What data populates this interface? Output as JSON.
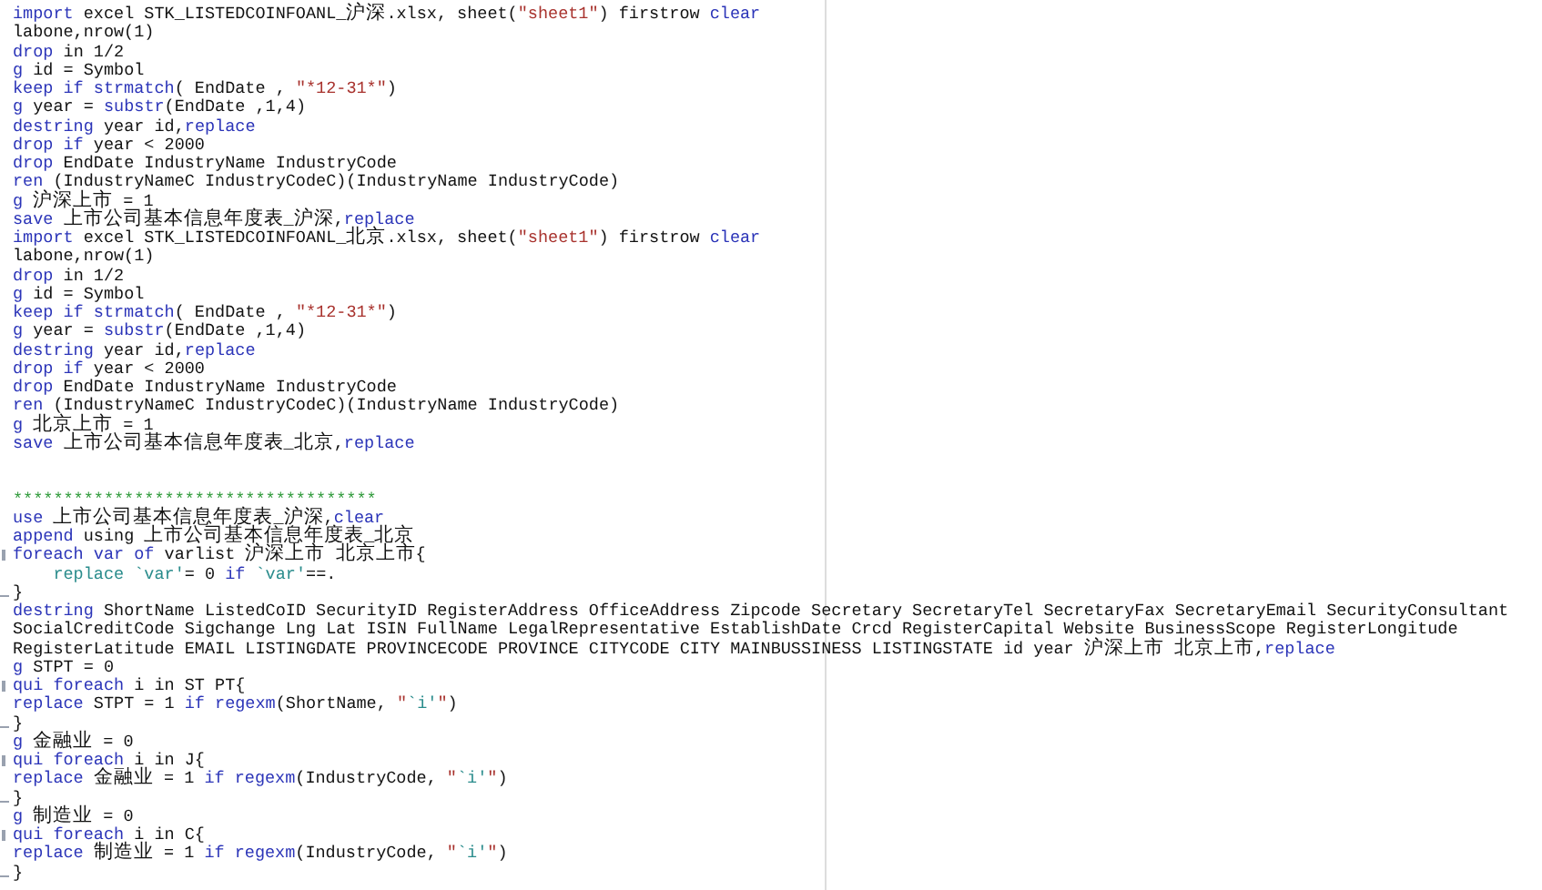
{
  "editor": {
    "lines": [
      {
        "kind": "code",
        "tokens": [
          {
            "kind": "keyword",
            "text": "import"
          },
          {
            "kind": "plain",
            "text": " excel STK_LISTEDCOINFOANL_沪深.xlsx, sheet("
          },
          {
            "kind": "string",
            "text": "\"sheet1\""
          },
          {
            "kind": "plain",
            "text": ") firstrow "
          },
          {
            "kind": "keyword",
            "text": "clear"
          }
        ]
      },
      {
        "kind": "code",
        "tokens": [
          {
            "kind": "plain",
            "text": "labone,nrow(1)"
          }
        ]
      },
      {
        "kind": "code",
        "tokens": [
          {
            "kind": "keyword",
            "text": "drop"
          },
          {
            "kind": "plain",
            "text": " in 1/2"
          }
        ]
      },
      {
        "kind": "code",
        "tokens": [
          {
            "kind": "keyword",
            "text": "g"
          },
          {
            "kind": "plain",
            "text": " id = Symbol"
          }
        ]
      },
      {
        "kind": "code",
        "tokens": [
          {
            "kind": "keyword",
            "text": "keep if strmatch"
          },
          {
            "kind": "plain",
            "text": "( EndDate , "
          },
          {
            "kind": "string",
            "text": "\"*12-31*\""
          },
          {
            "kind": "plain",
            "text": ")"
          }
        ]
      },
      {
        "kind": "code",
        "tokens": [
          {
            "kind": "keyword",
            "text": "g"
          },
          {
            "kind": "plain",
            "text": " year = "
          },
          {
            "kind": "keyword",
            "text": "substr"
          },
          {
            "kind": "plain",
            "text": "(EndDate ,1,4)"
          }
        ]
      },
      {
        "kind": "code",
        "tokens": [
          {
            "kind": "keyword",
            "text": "destring"
          },
          {
            "kind": "plain",
            "text": " year id,"
          },
          {
            "kind": "keyword",
            "text": "replace"
          }
        ]
      },
      {
        "kind": "code",
        "tokens": [
          {
            "kind": "keyword",
            "text": "drop if"
          },
          {
            "kind": "plain",
            "text": " year < 2000"
          }
        ]
      },
      {
        "kind": "code",
        "tokens": [
          {
            "kind": "keyword",
            "text": "drop"
          },
          {
            "kind": "plain",
            "text": " EndDate IndustryName IndustryCode"
          }
        ]
      },
      {
        "kind": "code",
        "tokens": [
          {
            "kind": "keyword",
            "text": "ren"
          },
          {
            "kind": "plain",
            "text": " (IndustryNameC IndustryCodeC)(IndustryName IndustryCode)"
          }
        ]
      },
      {
        "kind": "code",
        "tokens": [
          {
            "kind": "keyword",
            "text": "g"
          },
          {
            "kind": "plain",
            "text": " 沪深上市 = 1"
          }
        ]
      },
      {
        "kind": "code",
        "tokens": [
          {
            "kind": "keyword",
            "text": "save"
          },
          {
            "kind": "plain",
            "text": " 上市公司基本信息年度表_沪深,"
          },
          {
            "kind": "keyword",
            "text": "replace"
          }
        ]
      },
      {
        "kind": "code",
        "tokens": [
          {
            "kind": "keyword",
            "text": "import"
          },
          {
            "kind": "plain",
            "text": " excel STK_LISTEDCOINFOANL_北京.xlsx, sheet("
          },
          {
            "kind": "string",
            "text": "\"sheet1\""
          },
          {
            "kind": "plain",
            "text": ") firstrow "
          },
          {
            "kind": "keyword",
            "text": "clear"
          }
        ]
      },
      {
        "kind": "code",
        "tokens": [
          {
            "kind": "plain",
            "text": "labone,nrow(1)"
          }
        ]
      },
      {
        "kind": "code",
        "tokens": [
          {
            "kind": "keyword",
            "text": "drop"
          },
          {
            "kind": "plain",
            "text": " in 1/2"
          }
        ]
      },
      {
        "kind": "code",
        "tokens": [
          {
            "kind": "keyword",
            "text": "g"
          },
          {
            "kind": "plain",
            "text": " id = Symbol"
          }
        ]
      },
      {
        "kind": "code",
        "tokens": [
          {
            "kind": "keyword",
            "text": "keep if strmatch"
          },
          {
            "kind": "plain",
            "text": "( EndDate , "
          },
          {
            "kind": "string",
            "text": "\"*12-31*\""
          },
          {
            "kind": "plain",
            "text": ")"
          }
        ]
      },
      {
        "kind": "code",
        "tokens": [
          {
            "kind": "keyword",
            "text": "g"
          },
          {
            "kind": "plain",
            "text": " year = "
          },
          {
            "kind": "keyword",
            "text": "substr"
          },
          {
            "kind": "plain",
            "text": "(EndDate ,1,4)"
          }
        ]
      },
      {
        "kind": "code",
        "tokens": [
          {
            "kind": "keyword",
            "text": "destring"
          },
          {
            "kind": "plain",
            "text": " year id,"
          },
          {
            "kind": "keyword",
            "text": "replace"
          }
        ]
      },
      {
        "kind": "code",
        "tokens": [
          {
            "kind": "keyword",
            "text": "drop if"
          },
          {
            "kind": "plain",
            "text": " year < 2000"
          }
        ]
      },
      {
        "kind": "code",
        "tokens": [
          {
            "kind": "keyword",
            "text": "drop"
          },
          {
            "kind": "plain",
            "text": " EndDate IndustryName IndustryCode"
          }
        ]
      },
      {
        "kind": "code",
        "tokens": [
          {
            "kind": "keyword",
            "text": "ren"
          },
          {
            "kind": "plain",
            "text": " (IndustryNameC IndustryCodeC)(IndustryName IndustryCode)"
          }
        ]
      },
      {
        "kind": "code",
        "tokens": [
          {
            "kind": "keyword",
            "text": "g"
          },
          {
            "kind": "plain",
            "text": " 北京上市 = 1"
          }
        ]
      },
      {
        "kind": "code",
        "tokens": [
          {
            "kind": "keyword",
            "text": "save"
          },
          {
            "kind": "plain",
            "text": " 上市公司基本信息年度表_北京,"
          },
          {
            "kind": "keyword",
            "text": "replace"
          }
        ]
      },
      {
        "kind": "blank"
      },
      {
        "kind": "blank"
      },
      {
        "kind": "code",
        "tokens": [
          {
            "kind": "comment",
            "text": "************************************"
          }
        ]
      },
      {
        "kind": "code",
        "tokens": [
          {
            "kind": "keyword",
            "text": "use"
          },
          {
            "kind": "plain",
            "text": " 上市公司基本信息年度表_沪深,"
          },
          {
            "kind": "keyword",
            "text": "clear"
          }
        ]
      },
      {
        "kind": "code",
        "tokens": [
          {
            "kind": "keyword",
            "text": "append"
          },
          {
            "kind": "plain",
            "text": " using 上市公司基本信息年度表_北京"
          }
        ]
      },
      {
        "kind": "opener",
        "tokens": [
          {
            "kind": "keyword",
            "text": "foreach var of"
          },
          {
            "kind": "plain",
            "text": " varlist 沪深上市 北京上市{"
          }
        ]
      },
      {
        "kind": "code",
        "tokens": [
          {
            "kind": "macro",
            "text": "    replace `var'"
          },
          {
            "kind": "plain",
            "text": "= 0 "
          },
          {
            "kind": "keyword",
            "text": "if"
          },
          {
            "kind": "macro",
            "text": " `var'"
          },
          {
            "kind": "plain",
            "text": "==."
          }
        ]
      },
      {
        "kind": "closer",
        "tokens": [
          {
            "kind": "plain",
            "text": "}"
          }
        ]
      },
      {
        "kind": "code",
        "tokens": [
          {
            "kind": "keyword",
            "text": "destring"
          },
          {
            "kind": "plain",
            "text": " ShortName ListedCoID SecurityID RegisterAddress OfficeAddress Zipcode Secretary SecretaryTel SecretaryFax SecretaryEmail SecurityConsultant"
          }
        ]
      },
      {
        "kind": "code",
        "tokens": [
          {
            "kind": "plain",
            "text": "SocialCreditCode Sigchange Lng Lat ISIN FullName LegalRepresentative EstablishDate Crcd RegisterCapital Website BusinessScope RegisterLongitude"
          }
        ]
      },
      {
        "kind": "code",
        "tokens": [
          {
            "kind": "plain",
            "text": "RegisterLatitude EMAIL LISTINGDATE PROVINCECODE PROVINCE CITYCODE CITY MAINBUSSINESS LISTINGSTATE id year 沪深上市 北京上市,"
          },
          {
            "kind": "keyword",
            "text": "replace"
          }
        ]
      },
      {
        "kind": "code",
        "tokens": [
          {
            "kind": "keyword",
            "text": "g"
          },
          {
            "kind": "plain",
            "text": " STPT = 0"
          }
        ]
      },
      {
        "kind": "opener",
        "tokens": [
          {
            "kind": "keyword",
            "text": "qui foreach"
          },
          {
            "kind": "plain",
            "text": " i in ST PT{"
          }
        ]
      },
      {
        "kind": "code",
        "tokens": [
          {
            "kind": "keyword",
            "text": "replace"
          },
          {
            "kind": "plain",
            "text": " STPT = 1 "
          },
          {
            "kind": "keyword",
            "text": "if regexm"
          },
          {
            "kind": "plain",
            "text": "(ShortName, "
          },
          {
            "kind": "string",
            "text": "\""
          },
          {
            "kind": "macro",
            "text": "`i'"
          },
          {
            "kind": "string",
            "text": "\""
          },
          {
            "kind": "plain",
            "text": ")"
          }
        ]
      },
      {
        "kind": "closer",
        "tokens": [
          {
            "kind": "plain",
            "text": "}"
          }
        ]
      },
      {
        "kind": "code",
        "tokens": [
          {
            "kind": "keyword",
            "text": "g"
          },
          {
            "kind": "plain",
            "text": " 金融业 = 0"
          }
        ]
      },
      {
        "kind": "opener",
        "tokens": [
          {
            "kind": "keyword",
            "text": "qui foreach"
          },
          {
            "kind": "plain",
            "text": " i in J{"
          }
        ]
      },
      {
        "kind": "code",
        "tokens": [
          {
            "kind": "keyword",
            "text": "replace"
          },
          {
            "kind": "plain",
            "text": " 金融业 = 1 "
          },
          {
            "kind": "keyword",
            "text": "if regexm"
          },
          {
            "kind": "plain",
            "text": "(IndustryCode, "
          },
          {
            "kind": "string",
            "text": "\""
          },
          {
            "kind": "macro",
            "text": "`i'"
          },
          {
            "kind": "string",
            "text": "\""
          },
          {
            "kind": "plain",
            "text": ")"
          }
        ]
      },
      {
        "kind": "closer",
        "tokens": [
          {
            "kind": "plain",
            "text": "}"
          }
        ]
      },
      {
        "kind": "code",
        "tokens": [
          {
            "kind": "keyword",
            "text": "g"
          },
          {
            "kind": "plain",
            "text": " 制造业 = 0"
          }
        ]
      },
      {
        "kind": "opener",
        "tokens": [
          {
            "kind": "keyword",
            "text": "qui foreach"
          },
          {
            "kind": "plain",
            "text": " i in C{"
          }
        ]
      },
      {
        "kind": "code",
        "tokens": [
          {
            "kind": "keyword",
            "text": "replace"
          },
          {
            "kind": "plain",
            "text": " 制造业 = 1 "
          },
          {
            "kind": "keyword",
            "text": "if regexm"
          },
          {
            "kind": "plain",
            "text": "(IndustryCode, "
          },
          {
            "kind": "string",
            "text": "\""
          },
          {
            "kind": "macro",
            "text": "`i'"
          },
          {
            "kind": "string",
            "text": "\""
          },
          {
            "kind": "plain",
            "text": ")"
          }
        ]
      },
      {
        "kind": "closer",
        "tokens": [
          {
            "kind": "plain",
            "text": "}"
          }
        ]
      }
    ]
  }
}
